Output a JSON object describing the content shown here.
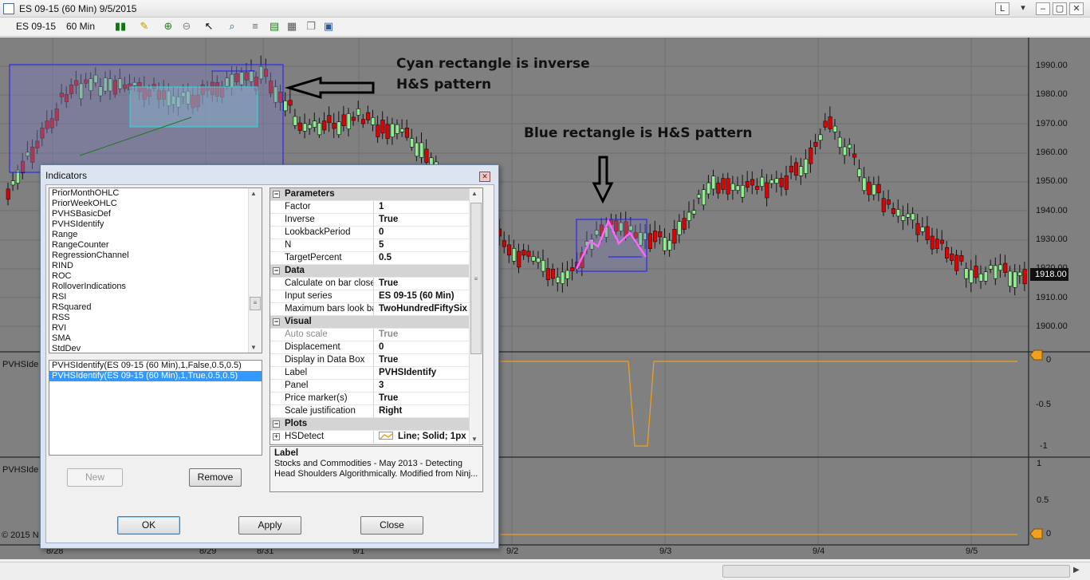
{
  "window": {
    "title": "ES 09-15 (60 Min)  9/5/2015",
    "buttons": [
      "L",
      "–",
      "▢",
      "✕"
    ]
  },
  "toolbar": {
    "instrument": "ES 09-15",
    "interval": "60 Min"
  },
  "annotations": {
    "cyan": "Cyan rectangle is inverse H&S pattern",
    "blue": "Blue rectangle is H&S pattern"
  },
  "price_axis": [
    "1990.00",
    "1980.00",
    "1970.00",
    "1960.00",
    "1950.00",
    "1940.00",
    "1930.00",
    "1920.00",
    "1910.00",
    "1900.00"
  ],
  "last_price": "1918.00",
  "panel2_axis": [
    "0",
    "-0.5",
    "-1"
  ],
  "panel3_axis": [
    "1",
    "0.5",
    "0"
  ],
  "date_axis": [
    "8/28",
    "8/29",
    "8/31",
    "9/1",
    "9/2",
    "9/3",
    "9/4",
    "9/5"
  ],
  "panel_labels": [
    "PVHSIde",
    "PVHSIde"
  ],
  "copyright": "© 2015 N",
  "dialog": {
    "title": "Indicators",
    "available": [
      "PriorMonthOHLC",
      "PriorWeekOHLC",
      "PVHSBasicDef",
      "PVHSIdentify",
      "Range",
      "RangeCounter",
      "RegressionChannel",
      "RIND",
      "ROC",
      "RolloverIndications",
      "RSI",
      "RSquared",
      "RSS",
      "RVI",
      "SMA",
      "StdDev"
    ],
    "applied": [
      "PVHSIdentify(ES 09-15 (60 Min),1,False,0.5,0.5)",
      "PVHSIdentify(ES 09-15 (60 Min),1,True,0.5,0.5)"
    ],
    "buttons": {
      "new": "New",
      "remove": "Remove",
      "ok": "OK",
      "apply": "Apply",
      "close": "Close"
    },
    "properties": [
      {
        "cat": "Parameters"
      },
      {
        "k": "Factor",
        "v": "1"
      },
      {
        "k": "Inverse",
        "v": "True"
      },
      {
        "k": "LookbackPeriod",
        "v": "0"
      },
      {
        "k": "N",
        "v": "5"
      },
      {
        "k": "TargetPercent",
        "v": "0.5"
      },
      {
        "cat": "Data"
      },
      {
        "k": "Calculate on bar close",
        "v": "True"
      },
      {
        "k": "Input series",
        "v": "ES 09-15 (60 Min)"
      },
      {
        "k": "Maximum bars look ba",
        "v": "TwoHundredFiftySix"
      },
      {
        "cat": "Visual"
      },
      {
        "k": "Auto scale",
        "v": "True",
        "gray": true
      },
      {
        "k": "Displacement",
        "v": "0"
      },
      {
        "k": "Display in Data Box",
        "v": "True"
      },
      {
        "k": "Label",
        "v": "PVHSIdentify"
      },
      {
        "k": "Panel",
        "v": "3"
      },
      {
        "k": "Price marker(s)",
        "v": "True"
      },
      {
        "k": "Scale justification",
        "v": "Right"
      },
      {
        "cat": "Plots"
      },
      {
        "k": "HSDetect",
        "v": "Line; Solid; 1px",
        "plot": true
      }
    ],
    "description": {
      "title": "Label",
      "text": "Stocks and Commodities - May 2013 - Detecting Head  Shoulders Algorithmically.  Modified from Ninj..."
    }
  }
}
